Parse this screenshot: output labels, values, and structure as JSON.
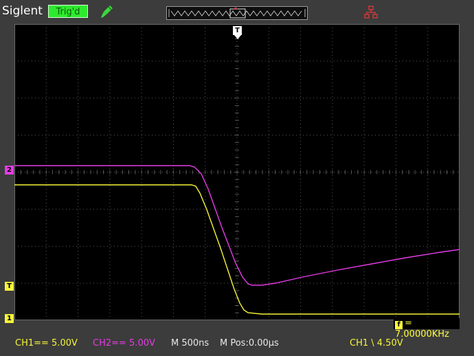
{
  "header": {
    "brand": "Siglent",
    "trigger_status": "Trig'd",
    "icons": [
      "probe-icon",
      "network-icon"
    ]
  },
  "screen": {
    "colors": {
      "ch1": "#f5f53a",
      "ch2": "#e63ce6",
      "grid": "#5a5a5a",
      "background": "#000000"
    },
    "markers": {
      "ch2_ground": "2",
      "trigger_level": "T",
      "ch1_ground": "1",
      "trigger_position": "T"
    },
    "frequency_label": "= 7.00000KHz",
    "frequency_icon": "f"
  },
  "status_bar": {
    "ch1": "CH1== 5.00V",
    "ch2": "CH2== 5.00V",
    "timebase": "M 500ns",
    "position": "M Pos:0.00µs",
    "trigger": "CH1 \\ 4.50V"
  }
}
